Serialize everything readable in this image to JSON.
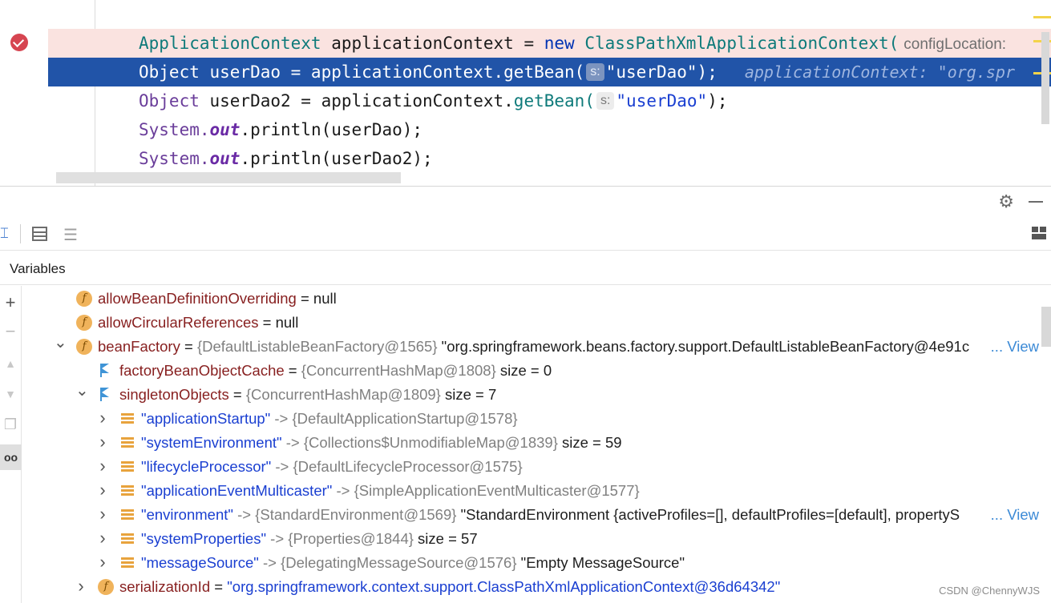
{
  "editor": {
    "lines": [
      {
        "parts": [
          {
            "t": "ApplicationContext",
            "c": "meth"
          },
          {
            "t": " applicationContext = ",
            "c": "plain"
          },
          {
            "t": "new",
            "c": "kw"
          },
          {
            "t": " ClassPathXmlApplicationContext(",
            "c": "meth"
          },
          {
            "hint": "configLocation:"
          }
        ],
        "state": "breakpoint"
      },
      {
        "parts": [
          {
            "t": "Object",
            "c": "typ"
          },
          {
            "t": " userDao = applicationContext.getBean(",
            "c": "plain"
          },
          {
            "hint": "s:"
          },
          {
            "t": "\"userDao\"",
            "c": "str"
          },
          {
            "t": ");",
            "c": "plain"
          },
          {
            "inline": "applicationContext: \"org.spr"
          }
        ],
        "state": "execution"
      },
      {
        "parts": [
          {
            "t": "Object",
            "c": "typ"
          },
          {
            "t": " userDao2 = applicationContext.",
            "c": "plain"
          },
          {
            "t": "getBean(",
            "c": "meth"
          },
          {
            "hint": "s:"
          },
          {
            "t": "\"userDao\"",
            "c": "strb"
          },
          {
            "t": ");",
            "c": "plain"
          }
        ],
        "state": "normal"
      },
      {
        "parts": [
          {
            "t": "System.",
            "c": "typ"
          },
          {
            "t": "out",
            "c": "fld"
          },
          {
            "t": ".println(userDao);",
            "c": "plain"
          }
        ],
        "state": "normal"
      },
      {
        "parts": [
          {
            "t": "System.",
            "c": "typ"
          },
          {
            "t": "out",
            "c": "fld"
          },
          {
            "t": ".println(userDao2);",
            "c": "plain"
          }
        ],
        "state": "normal"
      }
    ]
  },
  "panel": {
    "variables_title": "Variables"
  },
  "tree": [
    {
      "depth": 0,
      "expander": "",
      "icon": "f",
      "name": "allowBeanDefinitionOverriding",
      "name_style": "nm",
      "eq": " = ",
      "value": "null",
      "ref": "",
      "tail": "",
      "view": ""
    },
    {
      "depth": 0,
      "expander": "",
      "icon": "f",
      "name": "allowCircularReferences",
      "name_style": "nm",
      "eq": " = ",
      "value": "null",
      "ref": "",
      "tail": "",
      "view": ""
    },
    {
      "depth": 0,
      "expander": "down",
      "icon": "f",
      "name": "beanFactory",
      "name_style": "nm",
      "eq": " = ",
      "value": "",
      "ref": "{DefaultListableBeanFactory@1565}",
      "tail": " \"org.springframework.beans.factory.support.DefaultListableBeanFactory@4e91c",
      "view": "... View"
    },
    {
      "depth": 1,
      "expander": "",
      "icon": "flag",
      "name": "factoryBeanObjectCache",
      "name_style": "nm",
      "eq": " = ",
      "value": "",
      "ref": "{ConcurrentHashMap@1808}",
      "tail": "  size = 0",
      "view": ""
    },
    {
      "depth": 1,
      "expander": "down",
      "icon": "flag",
      "name": "singletonObjects",
      "name_style": "nm",
      "eq": " = ",
      "value": "",
      "ref": "{ConcurrentHashMap@1809}",
      "tail": "  size = 7",
      "view": ""
    },
    {
      "depth": 2,
      "expander": "right",
      "icon": "list",
      "name": "\"applicationStartup\"",
      "name_style": "key",
      "eq": " -> ",
      "value": "",
      "ref": "{DefaultApplicationStartup@1578}",
      "tail": "",
      "view": ""
    },
    {
      "depth": 2,
      "expander": "right",
      "icon": "list",
      "name": "\"systemEnvironment\"",
      "name_style": "key",
      "eq": " -> ",
      "value": "",
      "ref": "{Collections$UnmodifiableMap@1839}",
      "tail": "  size = 59",
      "view": ""
    },
    {
      "depth": 2,
      "expander": "right",
      "icon": "list",
      "name": "\"lifecycleProcessor\"",
      "name_style": "key",
      "eq": " -> ",
      "value": "",
      "ref": "{DefaultLifecycleProcessor@1575}",
      "tail": "",
      "view": ""
    },
    {
      "depth": 2,
      "expander": "right",
      "icon": "list",
      "name": "\"applicationEventMulticaster\"",
      "name_style": "key",
      "eq": " -> ",
      "value": "",
      "ref": "{SimpleApplicationEventMulticaster@1577}",
      "tail": "",
      "view": ""
    },
    {
      "depth": 2,
      "expander": "right",
      "icon": "list",
      "name": "\"environment\"",
      "name_style": "key",
      "eq": " -> ",
      "value": "",
      "ref": "{StandardEnvironment@1569}",
      "tail": " \"StandardEnvironment {activeProfiles=[], defaultProfiles=[default], propertyS",
      "view": "... View"
    },
    {
      "depth": 2,
      "expander": "right",
      "icon": "list",
      "name": "\"systemProperties\"",
      "name_style": "key",
      "eq": " -> ",
      "value": "",
      "ref": "{Properties@1844}",
      "tail": "  size = 57",
      "view": ""
    },
    {
      "depth": 2,
      "expander": "right",
      "icon": "list",
      "name": "\"messageSource\"",
      "name_style": "key",
      "eq": " -> ",
      "value": "",
      "ref": "{DelegatingMessageSource@1576}",
      "tail": " \"Empty MessageSource\"",
      "view": ""
    },
    {
      "depth": 1,
      "expander": "right",
      "icon": "f",
      "name": "serializationId",
      "name_style": "nm",
      "eq": " = ",
      "value": "",
      "ref": "",
      "tail": "",
      "str_value": "\"org.springframework.context.support.ClassPathXmlApplicationContext@36d64342\"",
      "view": ""
    }
  ],
  "watermark": "CSDN @ChennyWJS",
  "colors": {
    "execution_line": "#2154a8",
    "breakpoint_line": "#fae3e0",
    "field_icon": "#f0b35b",
    "link": "#3c8ad6"
  }
}
